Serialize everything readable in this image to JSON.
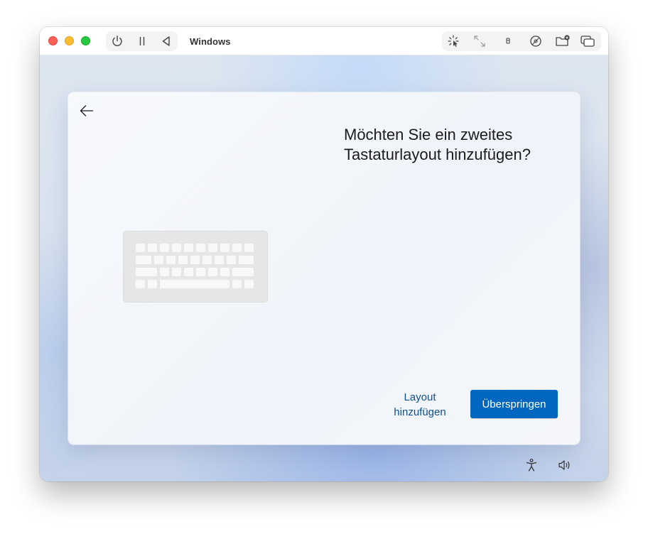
{
  "window": {
    "title": "Windows"
  },
  "toolbar": {
    "left_icons": [
      "power-icon",
      "pause-icon",
      "back-triangle-icon"
    ],
    "right_icons": [
      "capture-mouse-icon",
      "resize-icon",
      "usb-icon",
      "disc-icon",
      "shared-folder-icon",
      "windows-icon"
    ]
  },
  "oobe": {
    "heading": "Möchten Sie ein zweites Tastaturlayout hinzufügen?",
    "illustration": "keyboard-illustration",
    "add_layout_label": "Layout hinzufügen",
    "skip_label": "Überspringen"
  },
  "tray": {
    "icons": [
      "accessibility-icon",
      "volume-icon"
    ]
  },
  "colors": {
    "primary_button": "#0067c0",
    "link_text": "#0e4f91",
    "traffic_red": "#fe5f57",
    "traffic_yellow": "#febc2e",
    "traffic_green": "#28c840"
  }
}
